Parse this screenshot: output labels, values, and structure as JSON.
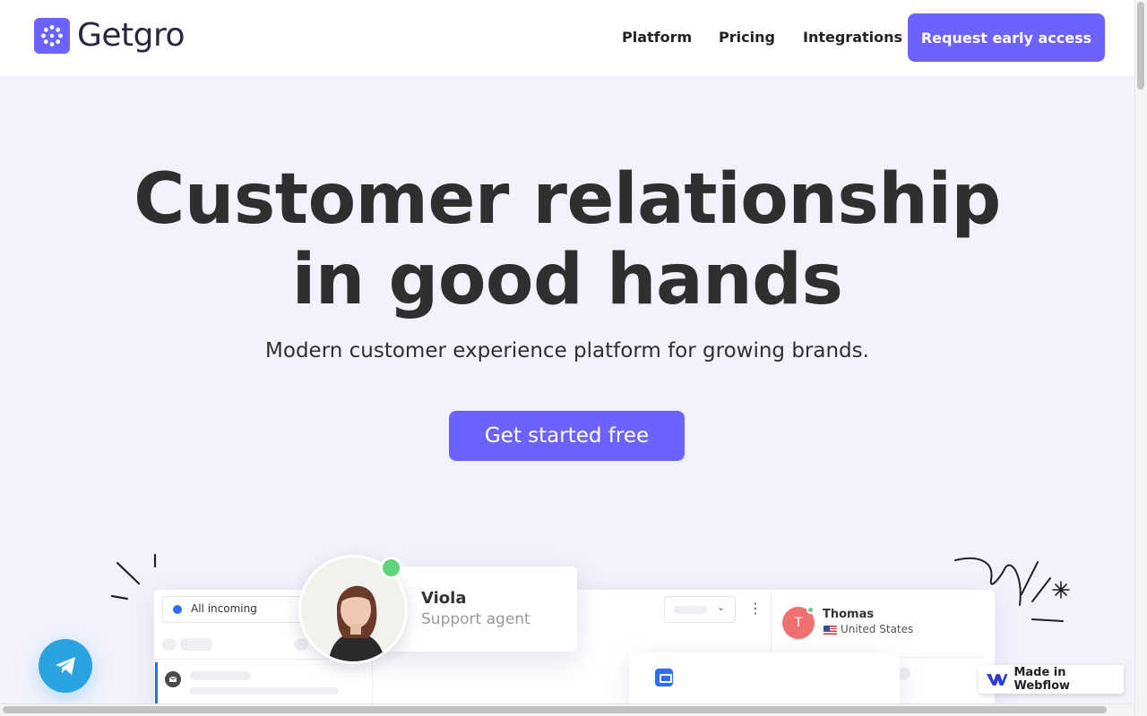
{
  "header": {
    "brand": "Getgro",
    "nav": [
      {
        "label": "Platform"
      },
      {
        "label": "Pricing"
      },
      {
        "label": "Integrations"
      }
    ],
    "cta_label": "Request early access"
  },
  "hero": {
    "title_line1": "Customer relationship",
    "title_line2": "in good hands",
    "subtitle": "Modern customer experience platform for growing brands.",
    "cta_label": "Get started free"
  },
  "mockup": {
    "inbox_filter": "All incoming",
    "agent": {
      "name": "Viola",
      "role": "Support agent",
      "status": "online"
    },
    "customer": {
      "initial": "T",
      "name": "Thomas",
      "country": "United States"
    }
  },
  "badge": {
    "label": "Made in Webflow"
  },
  "colors": {
    "brand": "#6c63ff",
    "hero_bg": "#f2f2fc",
    "online": "#5fd27a",
    "telegram": "#2aa3e0"
  },
  "icons": [
    "getgro-logo-icon",
    "telegram-icon",
    "webflow-icon",
    "mail-icon",
    "chat-icon",
    "chevron-down-icon",
    "kebab-icon"
  ]
}
